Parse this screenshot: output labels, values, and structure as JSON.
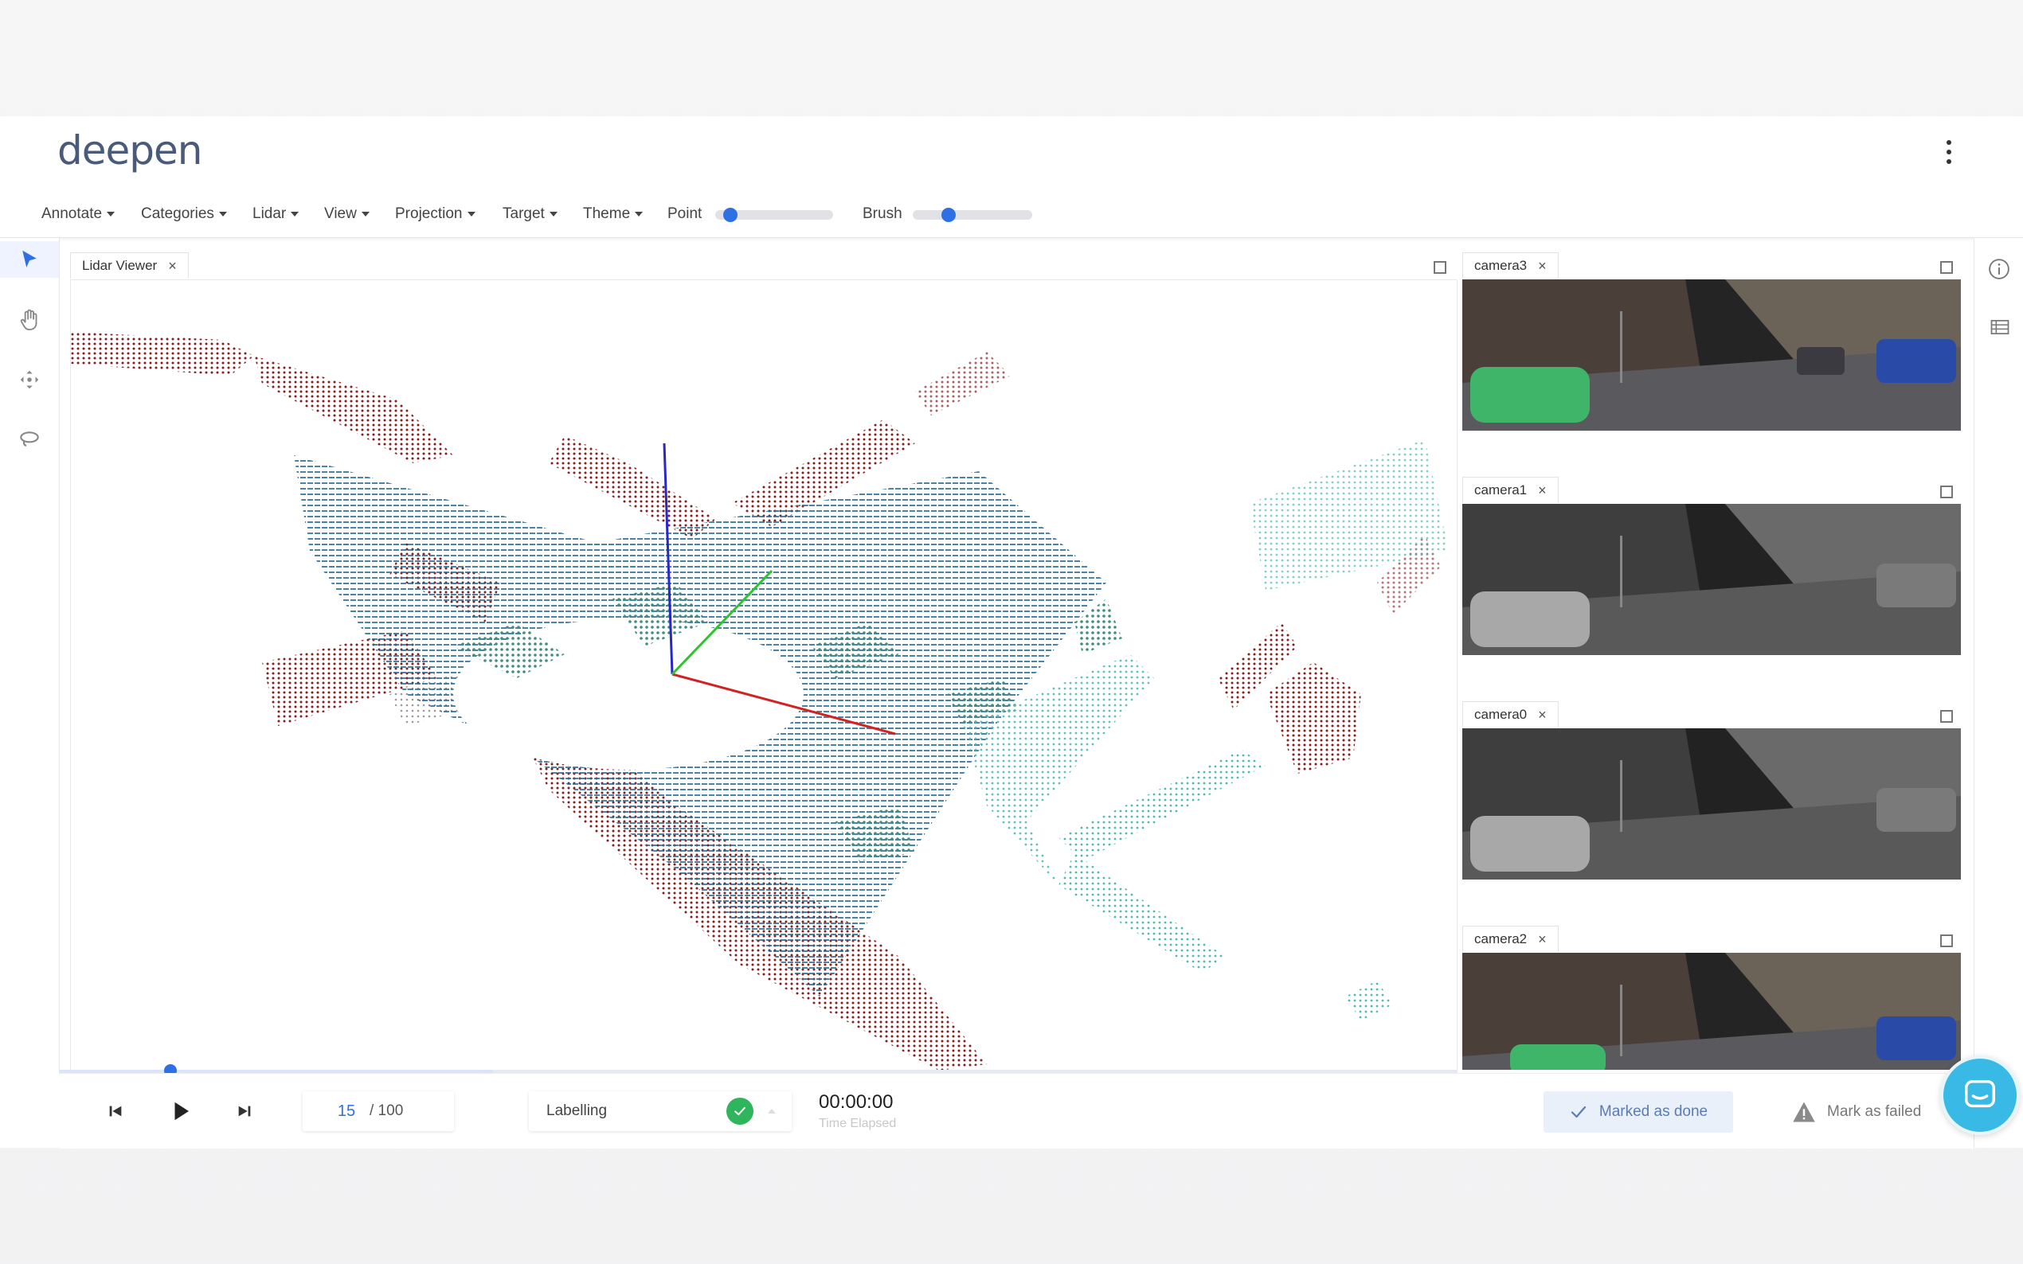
{
  "app": {
    "logo": "deepen"
  },
  "menubar": {
    "items": [
      {
        "label": "Annotate"
      },
      {
        "label": "Categories"
      },
      {
        "label": "Lidar"
      },
      {
        "label": "View"
      },
      {
        "label": "Projection"
      },
      {
        "label": "Target"
      },
      {
        "label": "Theme"
      }
    ],
    "point_label": "Point",
    "point_value": 0.08,
    "brush_label": "Brush",
    "brush_value": 0.27
  },
  "tools": [
    "select-arrow-icon",
    "hand-pan-icon",
    "move-icon",
    "lasso-icon"
  ],
  "right_tools": [
    "info-icon",
    "list-icon"
  ],
  "viewer": {
    "tab_label": "Lidar Viewer"
  },
  "cameras": [
    {
      "label": "camera3",
      "tint": "color"
    },
    {
      "label": "camera1",
      "tint": "gray"
    },
    {
      "label": "camera0",
      "tint": "gray"
    },
    {
      "label": "camera2",
      "tint": "color"
    }
  ],
  "playback": {
    "current_frame": "15",
    "total_frames": "/ 100",
    "progress": 0.15
  },
  "status": {
    "label": "Labelling"
  },
  "timer": {
    "value": "00:00:00",
    "subtitle": "Time Elapsed"
  },
  "actions": {
    "done_label": "Marked as done",
    "fail_label": "Mark as failed"
  },
  "colors": {
    "accent": "#2f6fe6",
    "done_green": "#2fb65c",
    "chat": "#38b9e6"
  }
}
